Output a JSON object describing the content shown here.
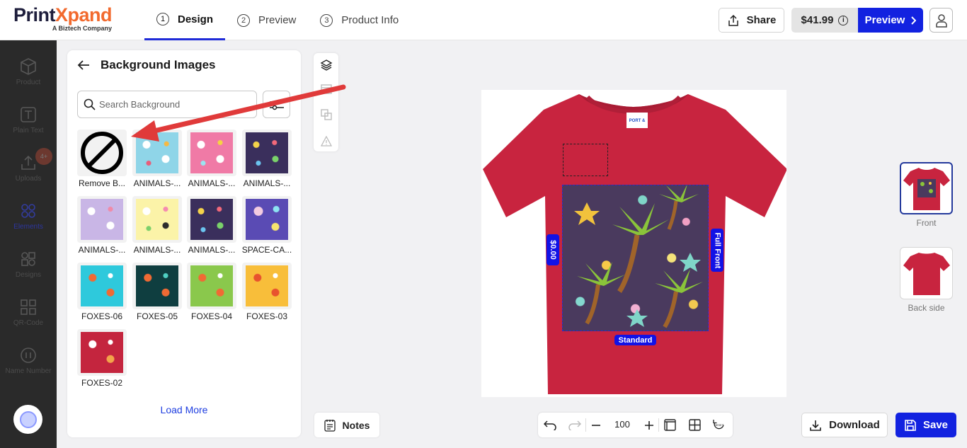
{
  "brand": {
    "name_part1": "Print",
    "name_part2": "Xpand",
    "tagline": "A Biztech Company"
  },
  "steps": [
    {
      "num": "1",
      "label": "Design",
      "active": true
    },
    {
      "num": "2",
      "label": "Preview",
      "active": false
    },
    {
      "num": "3",
      "label": "Product Info",
      "active": false
    }
  ],
  "header": {
    "share_label": "Share",
    "price": "$41.99",
    "preview_label": "Preview"
  },
  "rail": {
    "items": [
      {
        "label": "Product",
        "icon": "cube-icon"
      },
      {
        "label": "Plain Text",
        "icon": "text-icon"
      },
      {
        "label": "Uploads",
        "icon": "upload-icon",
        "badge": "4+"
      },
      {
        "label": "Elements",
        "icon": "elements-icon",
        "active": true
      },
      {
        "label": "Designs",
        "icon": "designs-icon"
      },
      {
        "label": "QR-Code",
        "icon": "qr-code-icon"
      },
      {
        "label": "Name Number",
        "icon": "name-number-icon"
      }
    ]
  },
  "panel": {
    "title": "Background Images",
    "search_placeholder": "Search Background",
    "tiles": [
      {
        "label": "Remove B...",
        "pattern": "remove"
      },
      {
        "label": "ANIMALS-...",
        "pattern": "p-cats-blue"
      },
      {
        "label": "ANIMALS-...",
        "pattern": "p-cats-pink"
      },
      {
        "label": "ANIMALS-...",
        "pattern": "p-cats-dark"
      },
      {
        "label": "ANIMALS-...",
        "pattern": "p-cats-lilac"
      },
      {
        "label": "ANIMALS-...",
        "pattern": "p-cats-yellow"
      },
      {
        "label": "ANIMALS-...",
        "pattern": "p-cats-dark"
      },
      {
        "label": "SPACE-CA...",
        "pattern": "p-space"
      },
      {
        "label": "FOXES-06",
        "pattern": "p-fox-cyan"
      },
      {
        "label": "FOXES-05",
        "pattern": "p-fox-dark"
      },
      {
        "label": "FOXES-04",
        "pattern": "p-fox-green"
      },
      {
        "label": "FOXES-03",
        "pattern": "p-fox-yellow"
      },
      {
        "label": "FOXES-02",
        "pattern": "p-fox-red"
      }
    ],
    "load_more": "Load More"
  },
  "canvas": {
    "tag_price": "$0.00",
    "tag_front": "Full Front",
    "tag_standard": "Standard",
    "shirt_color": "#c8243f",
    "neck_label": "PORT & COMPANY"
  },
  "views": [
    {
      "label": "Front",
      "active": true
    },
    {
      "label": "Back side",
      "active": false
    }
  ],
  "bottom": {
    "notes_label": "Notes",
    "zoom": "100",
    "download_label": "Download",
    "save_label": "Save"
  },
  "colors": {
    "accent": "#1222e0",
    "brand_orange": "#f26a2e",
    "annotation_arrow": "#e03a3a"
  }
}
